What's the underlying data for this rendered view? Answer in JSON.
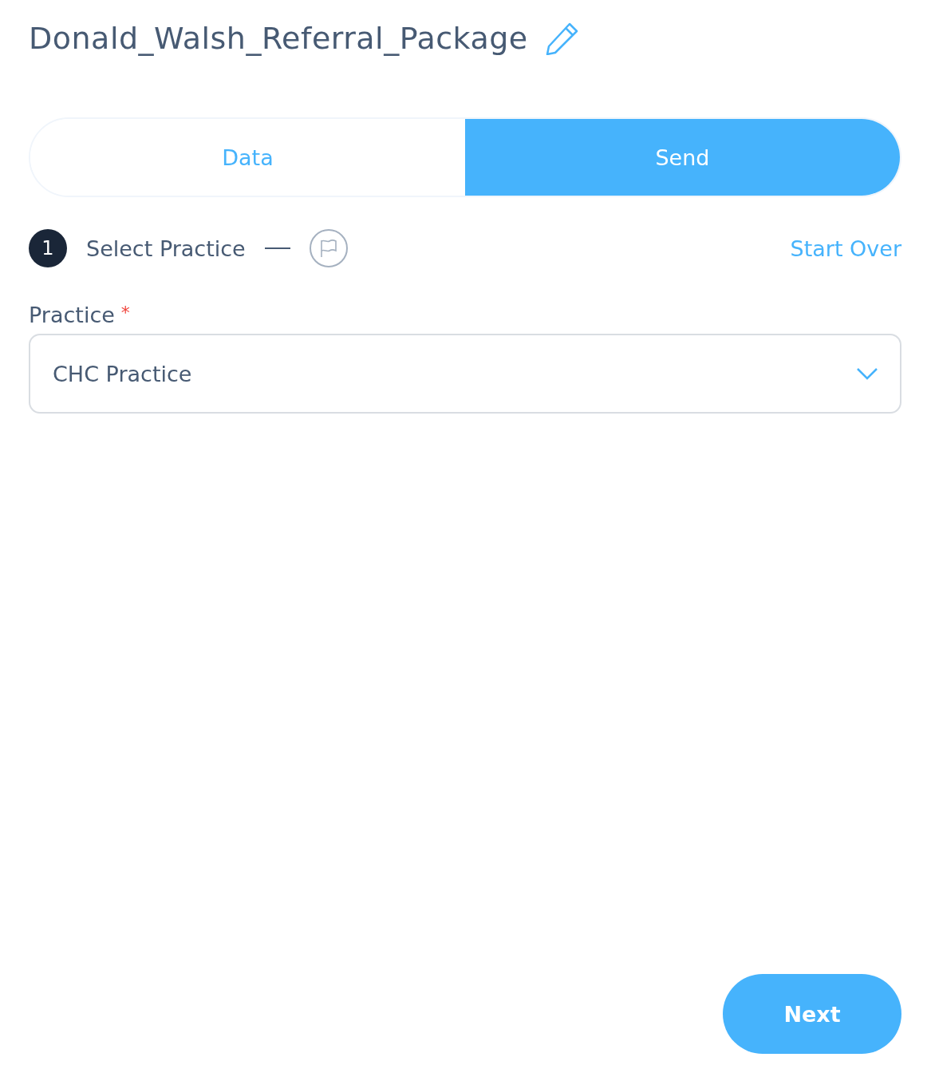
{
  "title": "Donald_Walsh_Referral_Package",
  "tabs": [
    {
      "label": "Data",
      "selected": false
    },
    {
      "label": "Send",
      "selected": true
    }
  ],
  "steps": [
    {
      "kind": "number",
      "number": "1",
      "label": "Select Practice",
      "selected": true
    },
    {
      "kind": "flag",
      "selected": false
    }
  ],
  "start_over": "Start Over",
  "practice_field": {
    "label": "Practice",
    "required_mark": "*",
    "value": "CHC Practice"
  },
  "next_button": "Next"
}
